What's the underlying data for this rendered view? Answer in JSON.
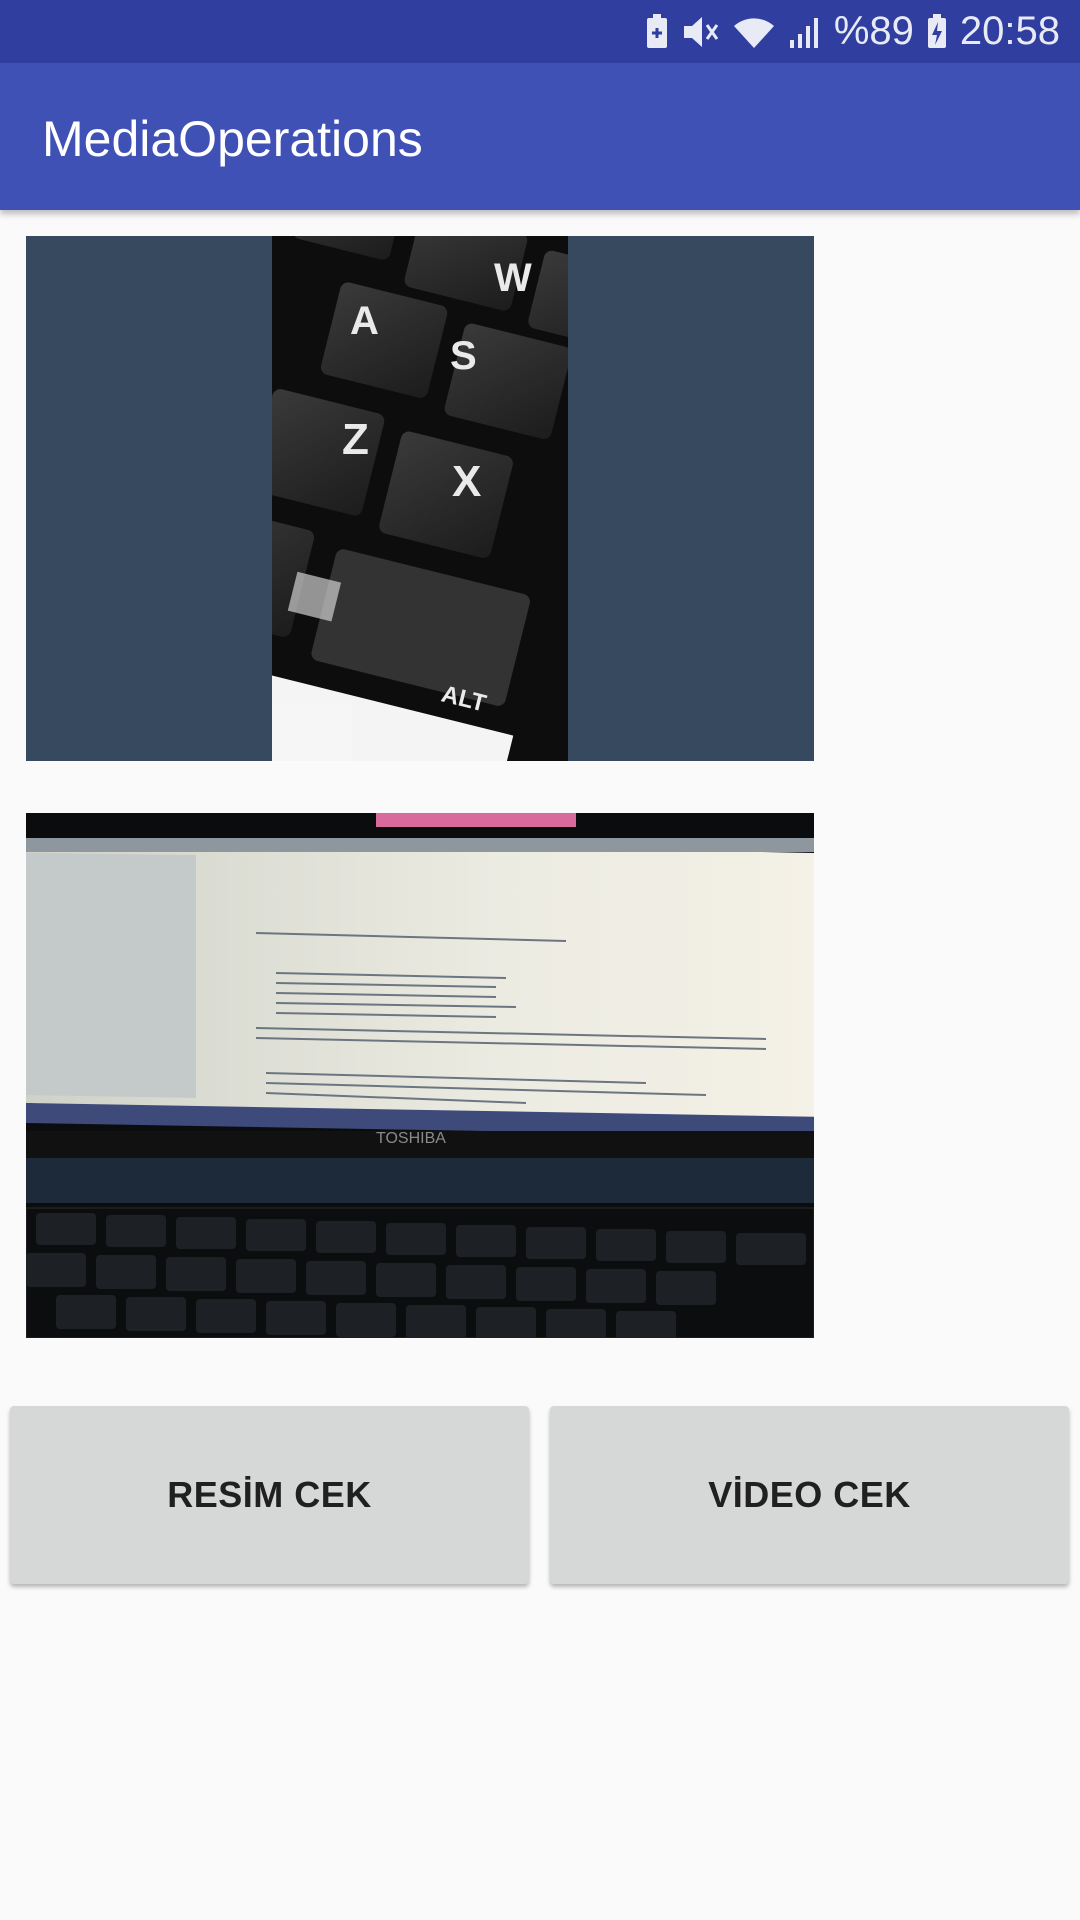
{
  "status_bar": {
    "battery_percent": "%89",
    "time": "20:58",
    "icons": [
      "battery-saver-icon",
      "mute-icon",
      "wifi-icon",
      "signal-icon",
      "battery-icon"
    ]
  },
  "app_bar": {
    "title": "MediaOperations"
  },
  "images": [
    {
      "name": "keyboard photo",
      "content": "laptop keyboard close-up"
    },
    {
      "name": "laptop screen video thumbnail",
      "content": "laptop screen showing IDE"
    }
  ],
  "photo_text": {
    "keys": [
      "W",
      "A",
      "S",
      "Z",
      "X",
      "ALT"
    ],
    "laptop_brand": "TOSHIBA"
  },
  "buttons": {
    "take_photo": "RESİM CEK",
    "take_video": "VİDEO CEK"
  },
  "colors": {
    "status_bar": "#303f9f",
    "app_bar": "#3f51b5",
    "image_background": "#37495e",
    "button": "#d6d7d7"
  }
}
